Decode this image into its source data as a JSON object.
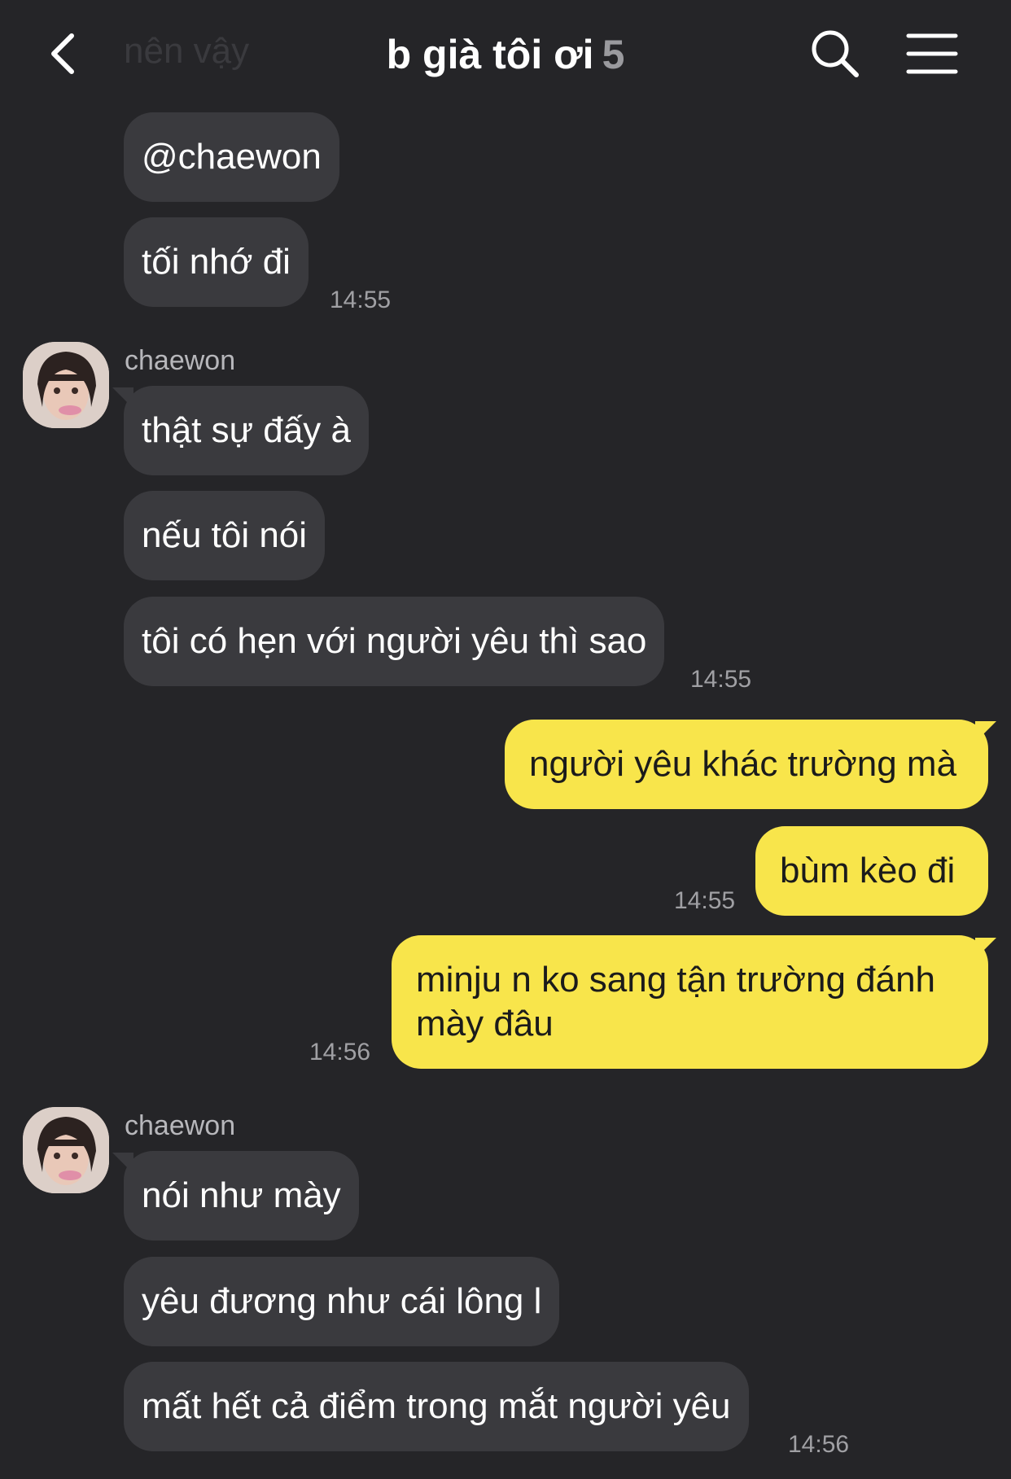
{
  "header": {
    "ghost_text": "nên vậy",
    "title": "b già tôi ơi",
    "member_count": "5",
    "icons": [
      "back-icon",
      "search-icon",
      "menu-icon"
    ]
  },
  "messages": [
    {
      "text": "@chaewon"
    },
    {
      "text": "tối nhớ đi",
      "time": "14:55"
    },
    {
      "sender": "chaewon",
      "text": "thật sự đấy à"
    },
    {
      "text": "nếu tôi nói"
    },
    {
      "text": "tôi có hẹn với người yêu thì sao",
      "time": "14:55"
    },
    {
      "text": "người yêu khác trường mà"
    },
    {
      "text": "bùm kèo đi",
      "time": "14:55"
    },
    {
      "text_line1": "minju n ko sang tận trường đánh",
      "text_line2": "mày đâu",
      "time": "14:56"
    },
    {
      "sender": "chaewon",
      "text": "nói như mày"
    },
    {
      "text": "yêu đương như cái lông l"
    },
    {
      "text": "mất hết cả điểm trong mắt người yêu",
      "time": "14:56"
    }
  ],
  "colors": {
    "background": "#252528",
    "incoming_bubble": "#3a3a3e",
    "outgoing_bubble": "#f8e54b",
    "timestamp": "#a0a0a4"
  }
}
